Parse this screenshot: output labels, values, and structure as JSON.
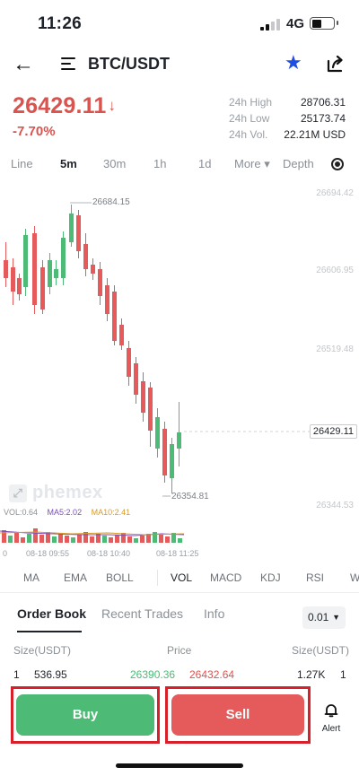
{
  "status_bar": {
    "time": "11:26",
    "network": "4G"
  },
  "header": {
    "pair": "BTC/USDT"
  },
  "ticker": {
    "last_price": "26429.11",
    "direction_arrow": "↓",
    "change_pct": "-7.70%",
    "stats": [
      {
        "label": "24h High",
        "value": "28706.31"
      },
      {
        "label": "24h Low",
        "value": "25173.74"
      },
      {
        "label": "24h Vol.",
        "value": "22.21M USD"
      }
    ]
  },
  "intervals": {
    "items": [
      "Line",
      "5m",
      "30m",
      "1h",
      "1d",
      "More ▾",
      "Depth"
    ],
    "active": "5m"
  },
  "chart": {
    "price_axis": [
      "26694.42",
      "26606.95",
      "26519.48",
      "26431.78",
      "26344.53"
    ],
    "current_price_tag": "26429.11",
    "high_marker": "26684.15",
    "low_marker": "26354.81",
    "watermark": "phemex",
    "volume_legend": [
      {
        "text": "VOL:0.64",
        "color": "#8b9096"
      },
      {
        "text": "MA5:2.02",
        "color": "#7b4fb8"
      },
      {
        "text": "MA10:2.41",
        "color": "#d79b2a"
      }
    ],
    "time_axis": [
      "0",
      "08-18 09:55",
      "08-18 10:40",
      "08-18 11:25"
    ],
    "up_color": "#4dbb76",
    "down_color": "#e55a5a"
  },
  "indicators": {
    "items": [
      "MA",
      "EMA",
      "BOLL",
      "VOL",
      "MACD",
      "KDJ",
      "RSI",
      "W"
    ],
    "active": "VOL"
  },
  "order_book": {
    "tabs": [
      "Order Book",
      "Recent Trades",
      "Info"
    ],
    "active_tab": "Order Book",
    "precision": "0.01",
    "headers": {
      "left_size": "Size(USDT)",
      "price": "Price",
      "right_size": "Size(USDT)"
    },
    "rows": [
      {
        "index_left": "1",
        "bid_size": "536.95",
        "bid_price": "26390.36",
        "ask_price": "26432.64",
        "ask_size": "1.27K",
        "index_right": "1"
      }
    ]
  },
  "actions": {
    "buy": "Buy",
    "sell": "Sell",
    "alert": "Alert"
  },
  "colors": {
    "accent_red": "#d9534f",
    "buy_green": "#4dbb76",
    "sell_red": "#e55a5a",
    "star_blue": "#1f4fe0",
    "highlight_border": "#d8202a"
  }
}
